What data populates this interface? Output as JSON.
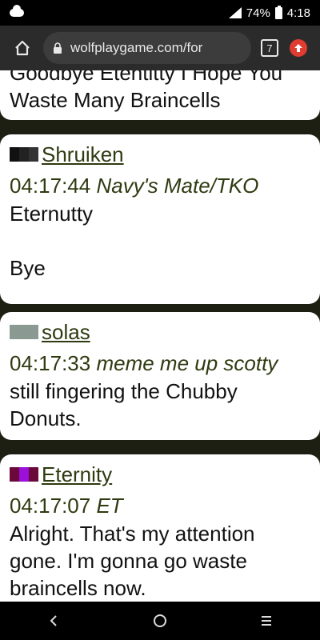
{
  "status": {
    "battery": "74%",
    "time": "4:18",
    "network": "4G"
  },
  "browser": {
    "url": "wolfplaygame.com/for",
    "tab_count": "7"
  },
  "posts": [
    {
      "body": "Goodbye Etentitty I Hope You Waste Many Braincells"
    },
    {
      "author": "Shruiken",
      "time": "04:17:44",
      "role": "Navy's Mate/TKO",
      "line1": "Eternutty",
      "line2": "Bye",
      "colors": [
        "#111111",
        "#222222",
        "#333333"
      ]
    },
    {
      "author": "solas",
      "time": "04:17:33",
      "role": "meme me up scotty",
      "body": "still fingering the Chubby Donuts.",
      "colors": [
        "#8a9a92",
        "#8a9a92",
        "#8a9a92"
      ]
    },
    {
      "author": "Eternity",
      "time": "04:17:07",
      "role": "ET",
      "body": "Alright. That's my attention gone. I'm gonna go waste braincells now.",
      "colors": [
        "#6b0a3a",
        "#9a10d8",
        "#6b0a3a"
      ]
    }
  ]
}
